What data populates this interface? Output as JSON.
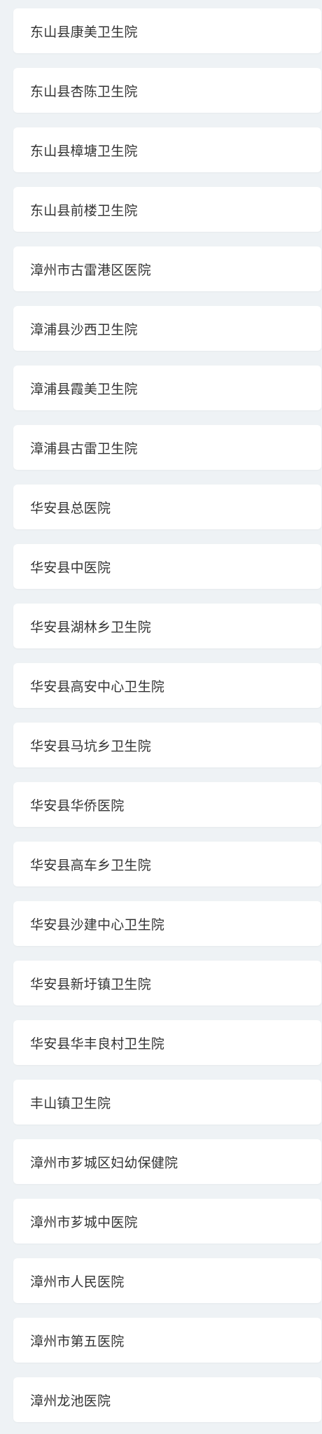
{
  "hospitals": [
    {
      "name": "东山县康美卫生院"
    },
    {
      "name": "东山县杏陈卫生院"
    },
    {
      "name": "东山县樟塘卫生院"
    },
    {
      "name": "东山县前楼卫生院"
    },
    {
      "name": "漳州市古雷港区医院"
    },
    {
      "name": "漳浦县沙西卫生院"
    },
    {
      "name": "漳浦县霞美卫生院"
    },
    {
      "name": "漳浦县古雷卫生院"
    },
    {
      "name": "华安县总医院"
    },
    {
      "name": "华安县中医院"
    },
    {
      "name": "华安县湖林乡卫生院"
    },
    {
      "name": "华安县高安中心卫生院"
    },
    {
      "name": "华安县马坑乡卫生院"
    },
    {
      "name": "华安县华侨医院"
    },
    {
      "name": "华安县高车乡卫生院"
    },
    {
      "name": "华安县沙建中心卫生院"
    },
    {
      "name": "华安县新圩镇卫生院"
    },
    {
      "name": "华安县华丰良村卫生院"
    },
    {
      "name": "丰山镇卫生院"
    },
    {
      "name": "漳州市芗城区妇幼保健院"
    },
    {
      "name": "漳州市芗城中医院"
    },
    {
      "name": "漳州市人民医院"
    },
    {
      "name": "漳州市第五医院"
    },
    {
      "name": "漳州龙池医院"
    }
  ]
}
